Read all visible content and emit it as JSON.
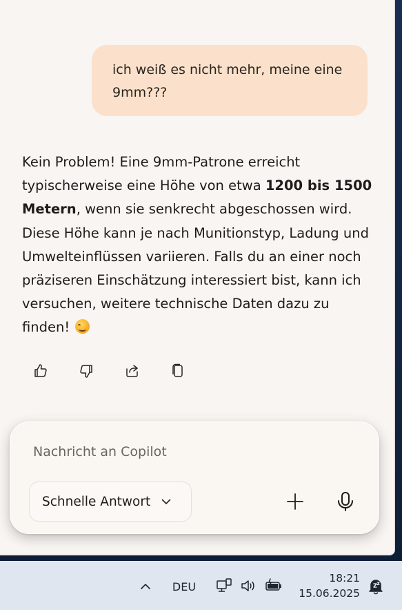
{
  "conversation": {
    "user_message": "ich weiß es nicht mehr, meine eine 9mm???",
    "assistant_message": {
      "part1": "Kein Problem! Eine 9mm-Patrone erreicht typischerweise eine Höhe von etwa ",
      "bold": "1200 bis 1500 Metern",
      "part2": ", wenn sie senkrecht abgeschossen wird. Diese Höhe kann je nach Munitionstyp, Ladung und Umwelteinflüssen variieren. Falls du an einer noch präziseren Einschätzung interessiert bist, kann ich versuchen, weitere technische Daten dazu zu finden! "
    },
    "actions": [
      {
        "name": "thumbs-up-icon"
      },
      {
        "name": "thumbs-down-icon"
      },
      {
        "name": "share-icon"
      },
      {
        "name": "copy-icon"
      }
    ]
  },
  "composer": {
    "placeholder": "Nachricht an Copilot",
    "mode_label": "Schnelle Antwort"
  },
  "taskbar": {
    "language": "DEU",
    "time": "18:21",
    "date": "15.06.2025"
  },
  "colors": {
    "user_bubble": "#fbe1cb",
    "window_bg": "#f8f5f2",
    "taskbar_bg": "#dfe6f0"
  }
}
